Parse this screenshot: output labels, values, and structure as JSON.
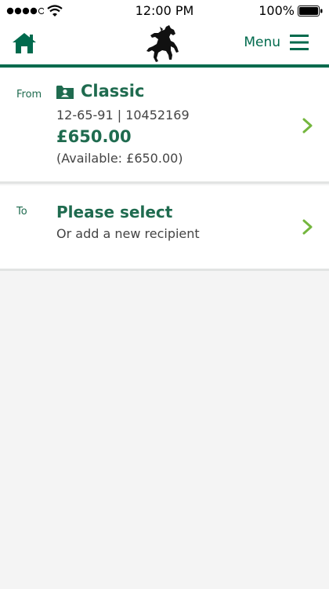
{
  "status_bar": {
    "time": "12:00 PM",
    "battery": "100%",
    "signal_icon": "signal-dots-icon",
    "wifi_icon": "wifi-icon",
    "battery_icon": "battery-icon"
  },
  "header": {
    "home_icon": "home-icon",
    "logo": "black-horse-logo",
    "menu_label": "Menu",
    "menu_icon": "hamburger-icon",
    "accent_color": "#006a4d"
  },
  "from": {
    "label": "From",
    "account_icon": "account-folder-icon",
    "account_name": "Classic",
    "account_number": "12-65-91 | 10452169",
    "balance": "£650.00",
    "available": "(Available: £650.00)",
    "chevron_icon": "chevron-right-icon"
  },
  "to": {
    "label": "To",
    "title": "Please select",
    "subtitle": "Or add a new recipient",
    "chevron_icon": "chevron-right-icon"
  },
  "colors": {
    "brand_green": "#006a4d",
    "text_green": "#1f6b4f",
    "chevron_green": "#74b63e"
  }
}
